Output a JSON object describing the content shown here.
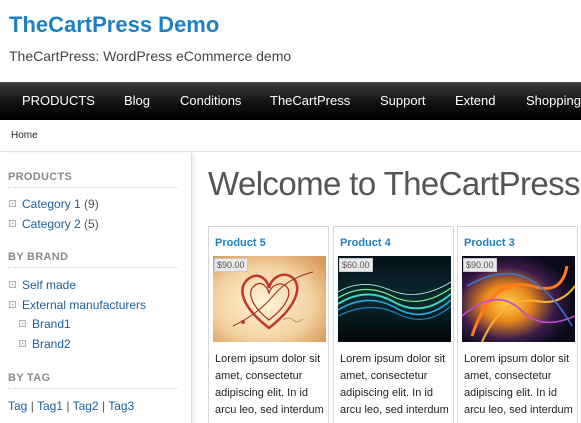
{
  "site": {
    "title": "TheCartPress Demo",
    "description": "TheCartPress: WordPress eCommerce demo"
  },
  "nav": [
    "PRODUCTS",
    "Blog",
    "Conditions",
    "TheCartPress",
    "Support",
    "Extend",
    "Shopping"
  ],
  "breadcrumb": "Home",
  "sidebar": {
    "products_title": "PRODUCTS",
    "categories": [
      {
        "label": "Category 1",
        "count": "(9)"
      },
      {
        "label": "Category 2",
        "count": "(5)"
      }
    ],
    "brand_title": "BY BRAND",
    "brands": [
      "Self made",
      "External manufacturers",
      "Brand1",
      "Brand2"
    ],
    "tag_title": "BY TAG",
    "tags": [
      "Tag",
      "Tag1",
      "Tag2",
      "Tag3"
    ],
    "tag_separator": "|"
  },
  "main": {
    "title": "Welcome to TheCartPress",
    "products": [
      {
        "name": "Product 5",
        "price": "$90.00",
        "description": "Lorem ipsum dolor sit amet, consectetur adipiscing elit. In id arcu leo, sed interdum"
      },
      {
        "name": "Product 4",
        "price": "$60.00",
        "description": "Lorem ipsum dolor sit amet, consectetur adipiscing elit. In id arcu leo, sed interdum"
      },
      {
        "name": "Product 3",
        "price": "$90.00",
        "description": "Lorem ipsum dolor sit amet, consectetur adipiscing elit. In id arcu leo, sed interdum"
      }
    ]
  },
  "colors": {
    "link": "#1f7fc4",
    "navbar": "#111111"
  }
}
